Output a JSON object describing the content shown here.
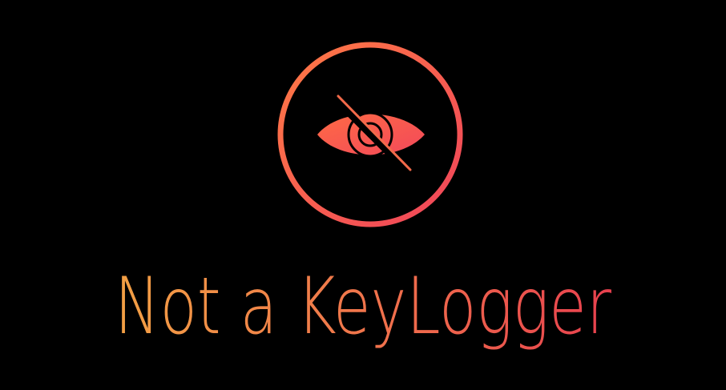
{
  "logo": {
    "title": "Not a KeyLogger",
    "icon": "eye-slash-icon"
  },
  "colors": {
    "background": "#000000",
    "gradient_start": "#ff7a45",
    "gradient_end": "#f0445a",
    "title_gradient_start": "#f2a044",
    "title_gradient_end": "#e8404e"
  }
}
